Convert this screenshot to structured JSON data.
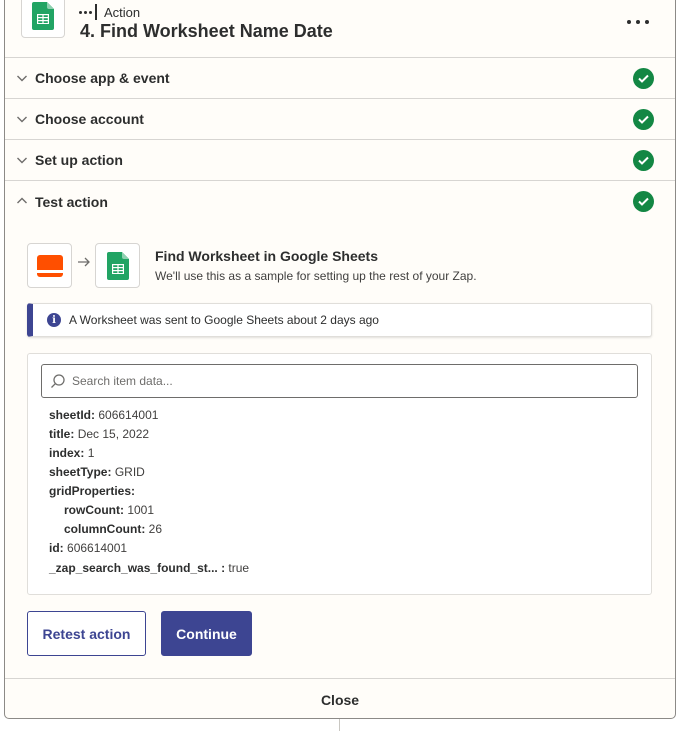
{
  "header": {
    "step_kind": "Action",
    "step_title": "4. Find Worksheet Name Date",
    "app_icon": "google-sheets-icon",
    "more_icon": "more-dots-icon"
  },
  "sections": [
    {
      "label": "Choose app & event",
      "expanded": false,
      "complete": true
    },
    {
      "label": "Choose account",
      "expanded": false,
      "complete": true
    },
    {
      "label": "Set up action",
      "expanded": false,
      "complete": true
    },
    {
      "label": "Test action",
      "expanded": true,
      "complete": true
    }
  ],
  "test": {
    "title": "Find Worksheet in Google Sheets",
    "subtitle": "We'll use this as a sample for setting up the rest of your Zap.",
    "banner": "A Worksheet was sent to Google Sheets about 2 days ago",
    "search_placeholder": "Search item data...",
    "fields": [
      {
        "key": "sheetId:",
        "value": "606614001"
      },
      {
        "key": "title:",
        "value": "Dec 15, 2022"
      },
      {
        "key": "index:",
        "value": "1"
      },
      {
        "key": "sheetType:",
        "value": "GRID"
      },
      {
        "key": "gridProperties:",
        "value": ""
      },
      {
        "key": "rowCount:",
        "value": "1001"
      },
      {
        "key": "columnCount:",
        "value": "26"
      },
      {
        "key": "id:",
        "value": "606614001"
      },
      {
        "key": "_zap_search_was_found_st... :",
        "value": "true"
      }
    ]
  },
  "buttons": {
    "retest": "Retest action",
    "continue": "Continue"
  },
  "footer": {
    "close": "Close"
  },
  "colors": {
    "accent": "#3d4592",
    "success": "#138744",
    "sheets_green": "#21a464",
    "trigger_orange": "#ff4f00"
  }
}
